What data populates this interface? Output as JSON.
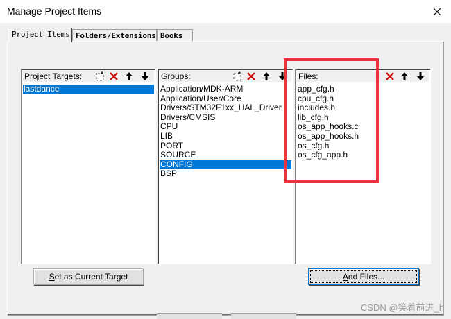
{
  "window": {
    "title": "Manage Project Items",
    "close_icon": "close-icon"
  },
  "tabs": [
    {
      "label": "Project Items",
      "active": true
    },
    {
      "label": "Folders/Extensions",
      "active": false
    },
    {
      "label": "Books",
      "active": false
    }
  ],
  "targets": {
    "header": "Project Targets:",
    "items": [
      {
        "label": "lastdance",
        "selected": true
      }
    ],
    "button_label": "Set as Current Target",
    "button_mnemonic": "S",
    "button_rest": "et as Current Target"
  },
  "groups": {
    "header": "Groups:",
    "items": [
      {
        "label": "Application/MDK-ARM",
        "selected": false
      },
      {
        "label": "Application/User/Core",
        "selected": false
      },
      {
        "label": "Drivers/STM32F1xx_HAL_Driver",
        "selected": false
      },
      {
        "label": "Drivers/CMSIS",
        "selected": false
      },
      {
        "label": "CPU",
        "selected": false
      },
      {
        "label": "LIB",
        "selected": false
      },
      {
        "label": "PORT",
        "selected": false
      },
      {
        "label": "SOURCE",
        "selected": false
      },
      {
        "label": "CONFIG",
        "selected": true
      },
      {
        "label": "BSP",
        "selected": false
      }
    ]
  },
  "files": {
    "header": "Files:",
    "items": [
      {
        "label": "app_cfg.h"
      },
      {
        "label": "cpu_cfg.h"
      },
      {
        "label": "includes.h"
      },
      {
        "label": "lib_cfg.h"
      },
      {
        "label": "os_app_hooks.c"
      },
      {
        "label": "os_app_hooks.h"
      },
      {
        "label": "os_cfg.h"
      },
      {
        "label": "os_cfg_app.h"
      }
    ],
    "button_label": "Add Files...",
    "button_mnemonic": "A",
    "button_rest": "dd Files..."
  },
  "colors": {
    "selection": "#0078d7",
    "highlight_box": "#e8343f",
    "delete_icon": "#cc0000"
  },
  "watermark": "CSDN @笑着前进_h"
}
